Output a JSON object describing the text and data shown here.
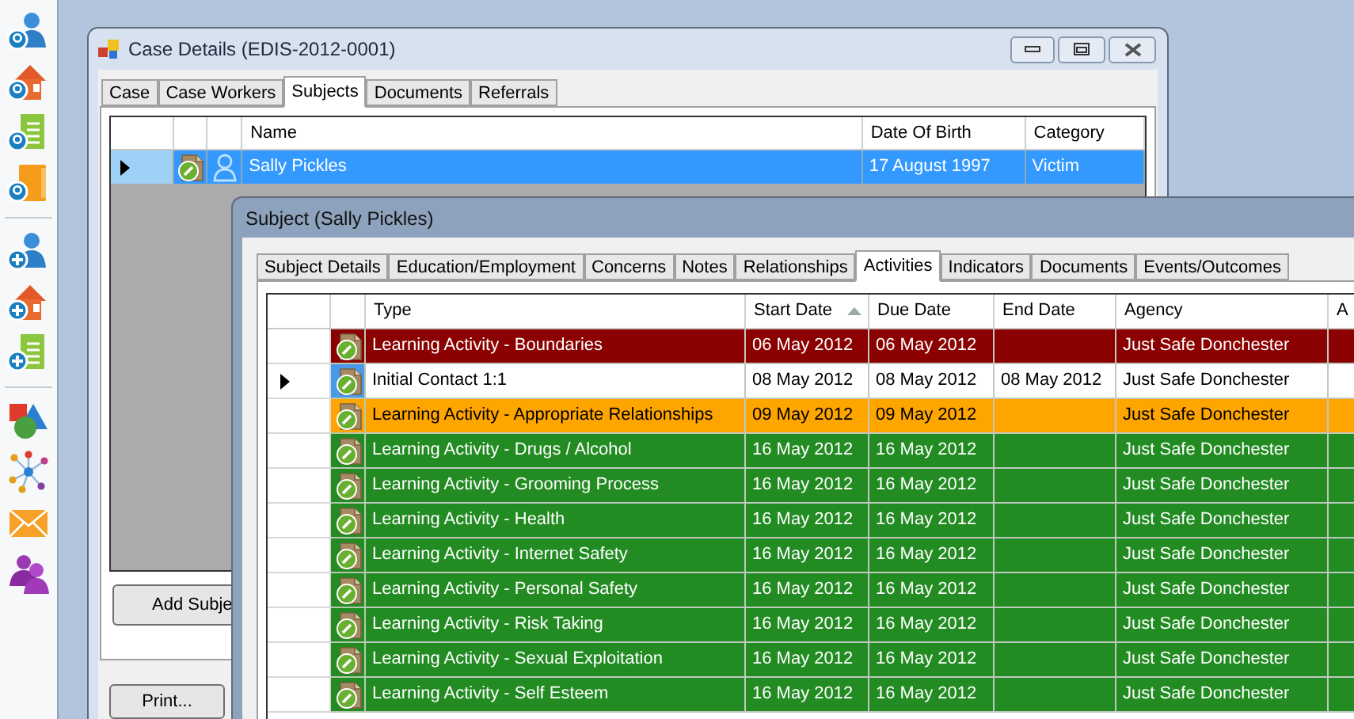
{
  "case_window": {
    "title": "Case Details (EDIS-2012-0001)",
    "tabs": [
      {
        "label": "Case",
        "selected": false
      },
      {
        "label": "Case Workers",
        "selected": false
      },
      {
        "label": "Subjects",
        "selected": true
      },
      {
        "label": "Documents",
        "selected": false
      },
      {
        "label": "Referrals",
        "selected": false
      }
    ],
    "columns": [
      "Name",
      "Date Of Birth",
      "Category"
    ],
    "rows": [
      {
        "name": "Sally Pickles",
        "date_of_birth": "17 August 1997",
        "category": "Victim",
        "selected": true
      }
    ],
    "add_button": "Add Subje",
    "print_button": "Print..."
  },
  "subject_window": {
    "title": "Subject (Sally Pickles)",
    "tabs": [
      {
        "label": "Subject Details",
        "selected": false
      },
      {
        "label": "Education/Employment",
        "selected": false
      },
      {
        "label": "Concerns",
        "selected": false
      },
      {
        "label": "Notes",
        "selected": false
      },
      {
        "label": "Relationships",
        "selected": false
      },
      {
        "label": "Activities",
        "selected": true
      },
      {
        "label": "Indicators",
        "selected": false
      },
      {
        "label": "Documents",
        "selected": false
      },
      {
        "label": "Events/Outcomes",
        "selected": false
      }
    ],
    "columns": [
      {
        "label": "Type",
        "sorted_ascending": false
      },
      {
        "label": "Start Date",
        "sorted_ascending": true
      },
      {
        "label": "Due Date",
        "sorted_ascending": false
      },
      {
        "label": "End Date",
        "sorted_ascending": false
      },
      {
        "label": "Agency",
        "sorted_ascending": false
      },
      {
        "label": "A",
        "sorted_ascending": false
      }
    ],
    "rows": [
      {
        "type": "Learning Activity - Boundaries",
        "start_date": "06 May 2012",
        "due_date": "06 May 2012",
        "agency": "Just Safe Donchester",
        "color": "#8b0000",
        "current": false
      },
      {
        "type": "Initial Contact 1:1",
        "start_date": "08 May 2012",
        "due_date": "08 May 2012",
        "end_date": "08 May 2012",
        "agency": "Just Safe Donchester",
        "color": "#ffffff",
        "current": true
      },
      {
        "type": "Learning Activity - Appropriate Relationships",
        "start_date": "09 May 2012",
        "due_date": "09 May 2012",
        "agency": "Just Safe Donchester",
        "color": "#ffa500",
        "current": false
      },
      {
        "type": "Learning Activity - Drugs / Alcohol",
        "start_date": "16 May 2012",
        "due_date": "16 May 2012",
        "agency": "Just Safe Donchester",
        "color": "#228b22",
        "current": false
      },
      {
        "type": "Learning Activity - Grooming Process",
        "start_date": "16 May 2012",
        "due_date": "16 May 2012",
        "agency": "Just Safe Donchester",
        "color": "#228b22",
        "current": false
      },
      {
        "type": "Learning Activity - Health",
        "start_date": "16 May 2012",
        "due_date": "16 May 2012",
        "agency": "Just Safe Donchester",
        "color": "#228b22",
        "current": false
      },
      {
        "type": "Learning Activity - Internet Safety",
        "start_date": "16 May 2012",
        "due_date": "16 May 2012",
        "agency": "Just Safe Donchester",
        "color": "#228b22",
        "current": false
      },
      {
        "type": "Learning Activity - Personal Safety",
        "start_date": "16 May 2012",
        "due_date": "16 May 2012",
        "agency": "Just Safe Donchester",
        "color": "#228b22",
        "current": false
      },
      {
        "type": "Learning Activity - Risk Taking",
        "start_date": "16 May 2012",
        "due_date": "16 May 2012",
        "agency": "Just Safe Donchester",
        "color": "#228b22",
        "current": false
      },
      {
        "type": "Learning Activity - Sexual Exploitation",
        "start_date": "16 May 2012",
        "due_date": "16 May 2012",
        "agency": "Just Safe Donchester",
        "color": "#228b22",
        "current": false
      },
      {
        "type": "Learning Activity - Self Esteem",
        "start_date": "16 May 2012",
        "due_date": "16 May 2012",
        "agency": "Just Safe Donchester",
        "color": "#228b22",
        "current": false
      }
    ]
  }
}
